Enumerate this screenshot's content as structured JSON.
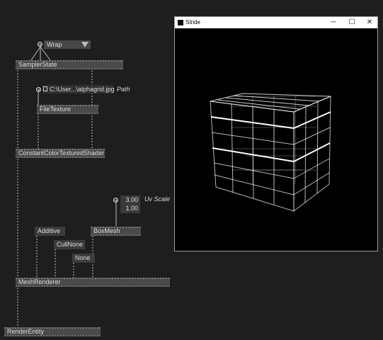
{
  "window": {
    "title": "Stride",
    "controls": {
      "minimize": "─",
      "maximize": "☐",
      "close": "✕"
    }
  },
  "wrap_dropdown": {
    "value": "Wrap"
  },
  "file_path": {
    "value": "C:\\User...\\alphagrid.jpg",
    "label": "Path"
  },
  "uv_scale": {
    "x": "3.00",
    "y": "1.00",
    "label": "Uv Scale"
  },
  "inputs": {
    "blend": "Additive",
    "cull": "CullNone",
    "depth": "None"
  },
  "nodes": {
    "sampler_state": "SamplerState",
    "file_texture": "FileTexture",
    "shader": "ConstantColorTexturedShader",
    "box_mesh": "BoxMesh",
    "mesh_renderer": "MeshRenderer",
    "render_entity": "RenderEntity"
  },
  "colors": {
    "canvas_bg": "#1e1e1e",
    "node_bg": "#4a4a4a",
    "wire": "#bdbdbd",
    "render_bg": "#000000",
    "cube_lines": "#ffffff"
  }
}
